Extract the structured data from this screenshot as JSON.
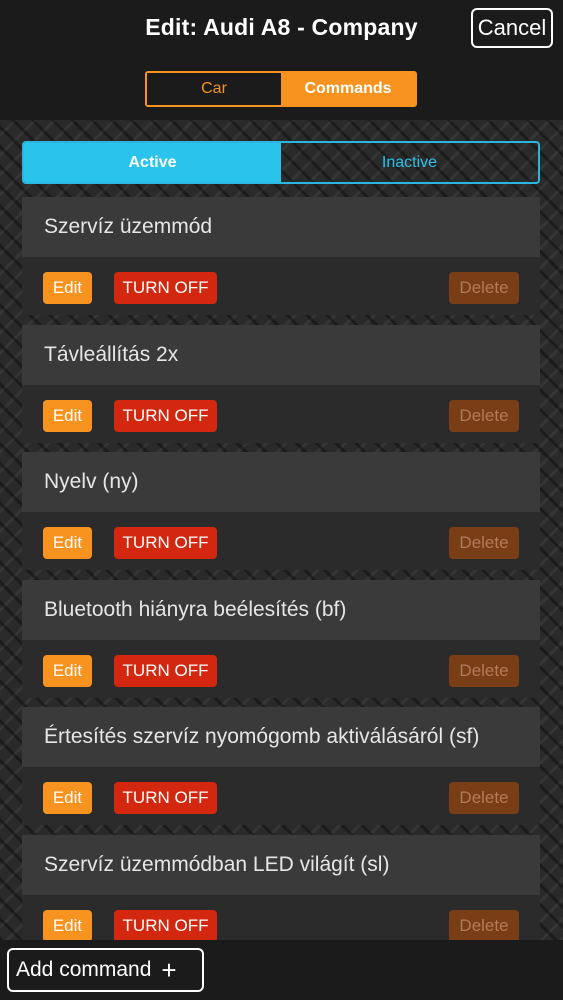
{
  "header": {
    "title": "Edit: Audi A8 - Company",
    "cancel_label": "Cancel"
  },
  "tabs": {
    "car_label": "Car",
    "commands_label": "Commands",
    "selected": "Commands"
  },
  "filter": {
    "active_label": "Active",
    "inactive_label": "Inactive",
    "selected": "Active"
  },
  "commands": [
    {
      "name": "Szervíz üzemmód",
      "edit_label": "Edit",
      "toggle_label": "TURN OFF",
      "delete_label": "Delete"
    },
    {
      "name": "Távleállítás 2x",
      "edit_label": "Edit",
      "toggle_label": "TURN OFF",
      "delete_label": "Delete"
    },
    {
      "name": "Nyelv (ny)",
      "edit_label": "Edit",
      "toggle_label": "TURN OFF",
      "delete_label": "Delete"
    },
    {
      "name": "Bluetooth hiányra beélesítés (bf)",
      "edit_label": "Edit",
      "toggle_label": "TURN OFF",
      "delete_label": "Delete"
    },
    {
      "name": "Értesítés szervíz nyomógomb aktiválásáról (sf)",
      "edit_label": "Edit",
      "toggle_label": "TURN OFF",
      "delete_label": "Delete"
    },
    {
      "name": "Szervíz üzemmódban LED világít (sl)",
      "edit_label": "Edit",
      "toggle_label": "TURN OFF",
      "delete_label": "Delete"
    }
  ],
  "footer": {
    "add_label": "Add command",
    "add_icon": "plus-icon"
  },
  "colors": {
    "accent_orange": "#f7931e",
    "active_blue": "#29c3ec",
    "turn_off_red": "#d4270f",
    "delete_brown": "#7a3e16"
  }
}
